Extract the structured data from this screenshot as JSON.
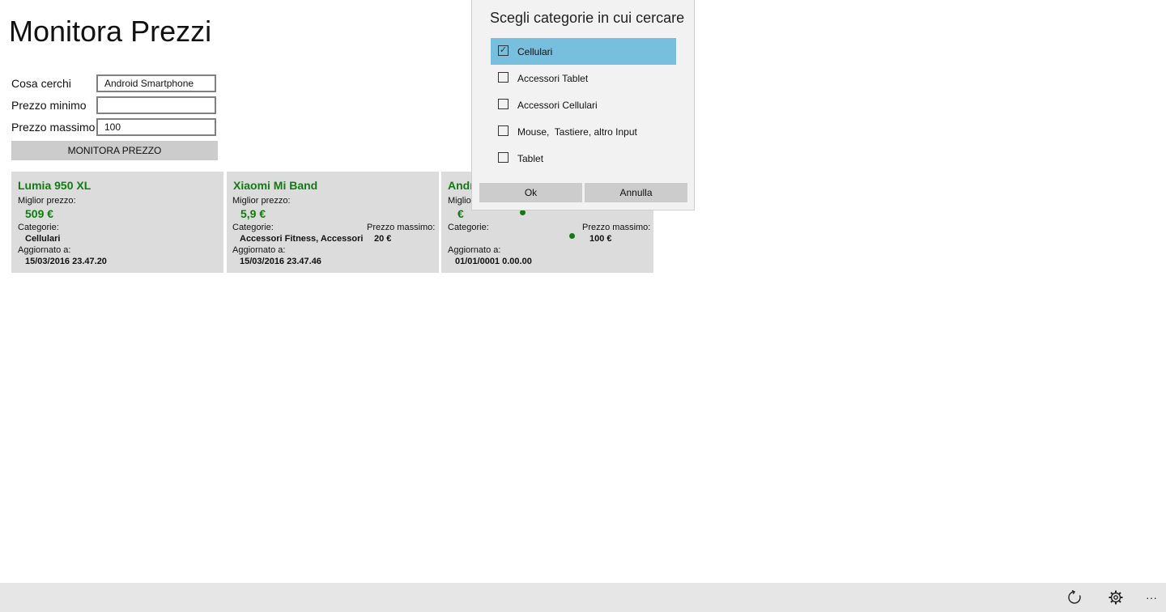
{
  "app": {
    "title": "Monitora Prezzi"
  },
  "form": {
    "what_label": "Cosa cerchi",
    "what_value": "Android Smartphone",
    "min_label": "Prezzo minimo",
    "min_value": "",
    "max_label": "Prezzo massimo",
    "max_value": "100",
    "monitor_button": "MONITORA PREZZO"
  },
  "cards": [
    {
      "name": "Lumia 950 XL",
      "best_price_label": "Miglior prezzo:",
      "best_price": "509 €",
      "categories_label": "Categorie:",
      "categories": "Cellulari",
      "updated_label": "Aggiornato a:",
      "updated": "15/03/2016 23.47.20"
    },
    {
      "name": "Xiaomi Mi Band",
      "best_price_label": "Miglior prezzo:",
      "best_price": "5,9 €",
      "categories_label": "Categorie:",
      "categories": "Accessori Fitness, Accessori Ce...",
      "max_price_label": "Prezzo massimo:",
      "max_price": "20 €",
      "updated_label": "Aggiornato a:",
      "updated": "15/03/2016 23.47.46"
    },
    {
      "name": "Andr",
      "best_price_label": "Miglio",
      "best_price": "€",
      "categories_label": "Categorie:",
      "max_price_label": "Prezzo massimo:",
      "max_price": "100 €",
      "updated_label": "Aggiornato a:",
      "updated": "01/01/0001 0.00.00",
      "status_color": "#107c10"
    }
  ],
  "dialog": {
    "title": "Scegli categorie in cui cercare",
    "options": [
      {
        "label": "Cellulari",
        "checked": true
      },
      {
        "label": "Accessori Tablet",
        "checked": false
      },
      {
        "label": "Accessori Cellulari",
        "checked": false
      },
      {
        "label": "Mouse,  Tastiere, altro Input",
        "checked": false
      },
      {
        "label": "Tablet",
        "checked": false
      }
    ],
    "ok_label": "Ok",
    "cancel_label": "Annulla"
  },
  "appbar": {
    "icons": [
      "refresh-icon",
      "gear-icon",
      "more-icon"
    ],
    "more_glyph": "···"
  },
  "colors": {
    "accent_green": "#107c10",
    "selected_blue": "#78bedd",
    "card_bg": "#dcdcdc"
  }
}
